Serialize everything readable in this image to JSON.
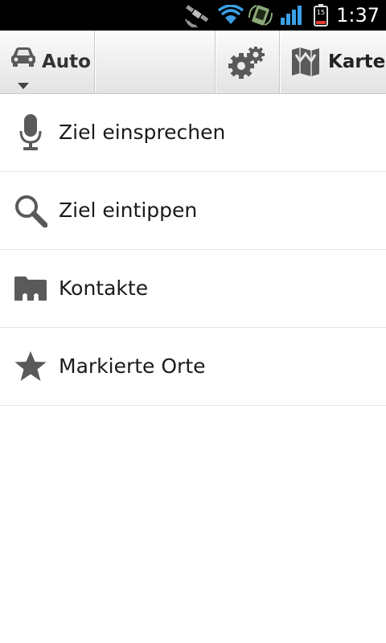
{
  "status_bar": {
    "time": "1:37",
    "battery_level": "15",
    "icons": [
      "gps-satellite-icon",
      "wifi-icon",
      "sync-icon",
      "signal-icon",
      "battery-icon"
    ]
  },
  "action_bar": {
    "mode_label": "Auto",
    "mode_icon": "car-icon",
    "settings_icon": "gears-icon",
    "map_label": "Karte",
    "map_icon": "map-icon"
  },
  "menu": {
    "items": [
      {
        "label": "Ziel einsprechen",
        "icon": "microphone-icon"
      },
      {
        "label": "Ziel eintippen",
        "icon": "magnifier-icon"
      },
      {
        "label": "Kontakte",
        "icon": "contacts-folder-icon"
      },
      {
        "label": "Markierte Orte",
        "icon": "star-icon"
      }
    ]
  },
  "colors": {
    "status_bar_bg": "#000000",
    "wifi_blue": "#3aa0e6",
    "icon_gray": "#5a5a5a",
    "divider": "#e6e6e6"
  }
}
